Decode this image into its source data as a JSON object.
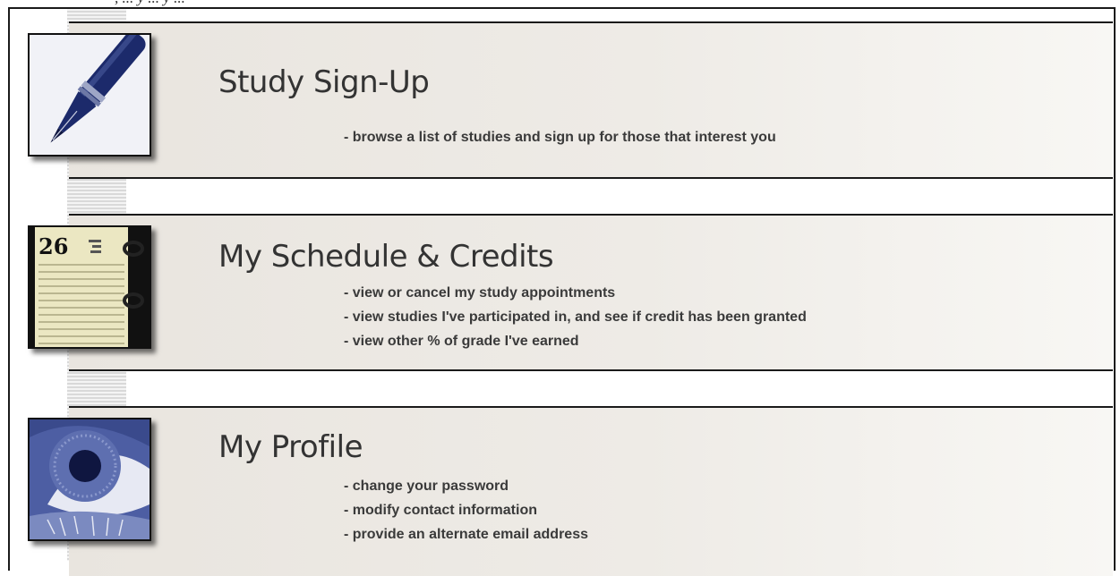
{
  "top_fragment": ", ... y ... y ...",
  "sections": [
    {
      "title": "Study Sign-Up",
      "icon": "fountain-pen-icon",
      "items": [
        "- browse a list of studies and sign up for those that interest you"
      ]
    },
    {
      "title": "My Schedule & Credits",
      "icon": "calendar-planner-icon",
      "calendar_day": "26",
      "items": [
        "- view or cancel my study appointments",
        "- view studies I've participated in, and see if credit has been granted",
        "- view other % of grade I've earned"
      ]
    },
    {
      "title": "My Profile",
      "icon": "eye-icon",
      "items": [
        "- change your password",
        "- modify contact information",
        "- provide an alternate email address"
      ]
    }
  ],
  "colors": {
    "panel": "#eeebe6",
    "rule": "#1a1a1a",
    "icon_blue": "#1c2a6b",
    "text": "#333333"
  }
}
